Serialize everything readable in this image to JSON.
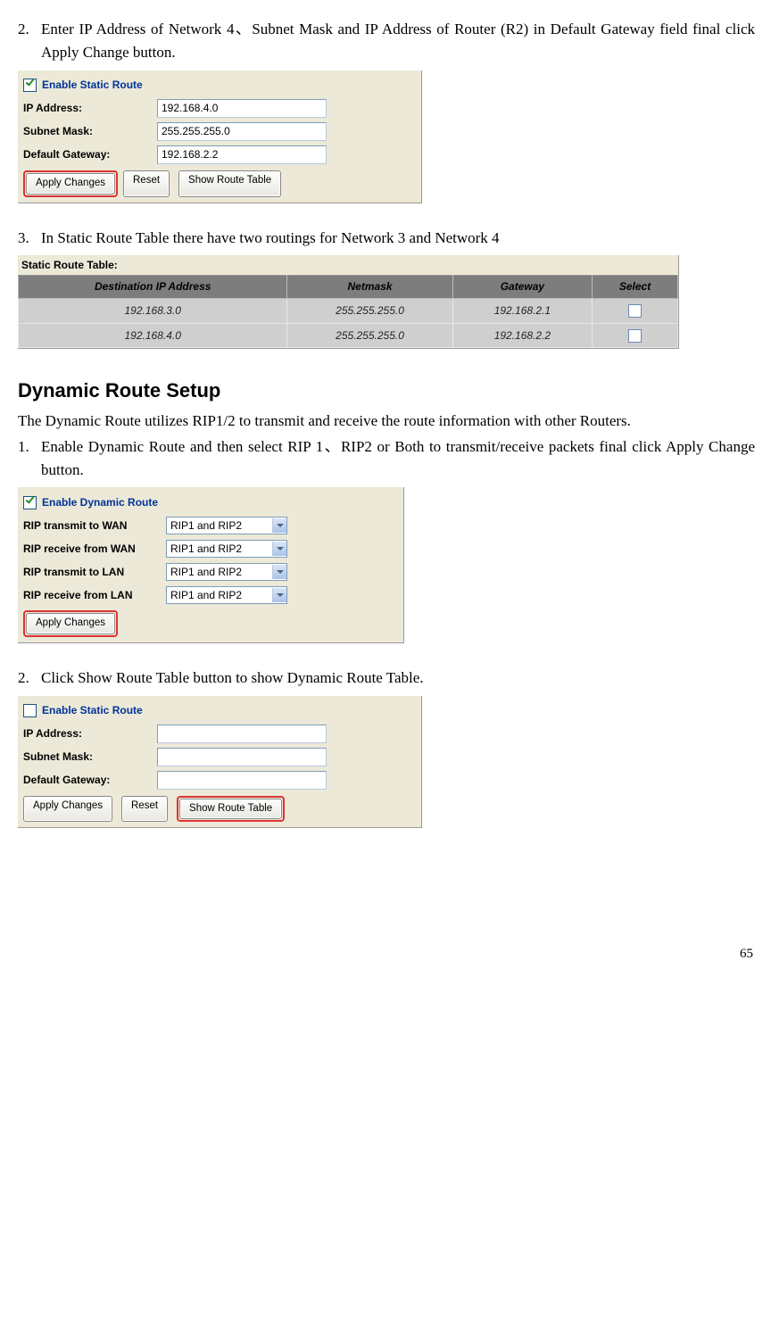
{
  "step2": {
    "num": "2.",
    "text": "Enter IP Address of Network 4、Subnet Mask and IP Address of Router (R2) in Default Gateway field final click Apply Change button."
  },
  "fig1": {
    "enable_label": "Enable Static Route",
    "ip_label": "IP Address:",
    "ip_value": "192.168.4.0",
    "mask_label": "Subnet Mask:",
    "mask_value": "255.255.255.0",
    "gw_label": "Default Gateway:",
    "gw_value": "192.168.2.2",
    "btn_apply": "Apply Changes",
    "btn_reset": "Reset",
    "btn_show": "Show Route Table"
  },
  "step3": {
    "num": "3.",
    "text": "In Static Route Table there have two routings for Network 3 and Network 4"
  },
  "route_table": {
    "title": "Static Route Table:",
    "headers": [
      "Destination IP Address",
      "Netmask",
      "Gateway",
      "Select"
    ],
    "rows": [
      {
        "dest": "192.168.3.0",
        "mask": "255.255.255.0",
        "gw": "192.168.2.1"
      },
      {
        "dest": "192.168.4.0",
        "mask": "255.255.255.0",
        "gw": "192.168.2.2"
      }
    ]
  },
  "section_heading": "Dynamic Route Setup",
  "section_intro": "The Dynamic Route utilizes RIP1/2 to transmit and receive the route information with other Routers.",
  "dyn_step1": {
    "num": "1.",
    "text": "Enable Dynamic Route and then select RIP 1、RIP2 or Both to transmit/receive packets final click Apply Change button."
  },
  "fig2": {
    "enable_label": "Enable Dynamic Route",
    "rows": [
      {
        "label": "RIP transmit to WAN",
        "value": "RIP1 and RIP2"
      },
      {
        "label": "RIP receive from WAN",
        "value": "RIP1 and RIP2"
      },
      {
        "label": "RIP transmit to LAN",
        "value": "RIP1 and RIP2"
      },
      {
        "label": "RIP receive from LAN",
        "value": "RIP1 and RIP2"
      }
    ],
    "btn_apply": "Apply Changes"
  },
  "dyn_step2": {
    "num": "2.",
    "text": "Click Show Route Table button to show Dynamic Route Table."
  },
  "fig3": {
    "enable_label": "Enable Static Route",
    "ip_label": "IP Address:",
    "ip_value": "",
    "mask_label": "Subnet Mask:",
    "mask_value": "",
    "gw_label": "Default Gateway:",
    "gw_value": "",
    "btn_apply": "Apply Changes",
    "btn_reset": "Reset",
    "btn_show": "Show Route Table"
  },
  "page_number": "65"
}
